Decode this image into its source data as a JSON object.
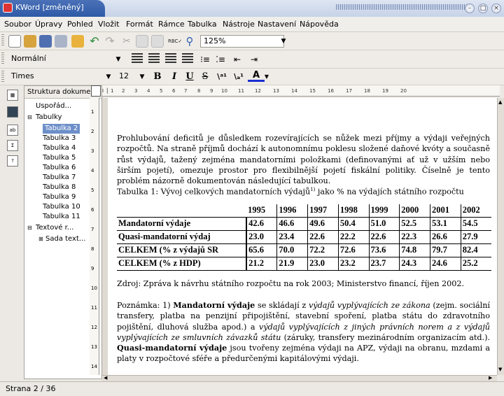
{
  "window": {
    "title": "KWord [změněný]"
  },
  "menubar": {
    "items": [
      "Soubor",
      "Úpravy",
      "Pohled",
      "Vložit",
      "Formát",
      "Rámce",
      "Tabulka",
      "Nástroje",
      "Nastavení",
      "Nápověda"
    ]
  },
  "toolbar": {
    "zoom": "125%",
    "style": "Normální",
    "font": "Times",
    "font_size": "12",
    "bold": "B",
    "italic": "I",
    "underline": "U",
    "strike": "S"
  },
  "doc_structure": {
    "header": "Struktura dokume",
    "items": [
      "Uspořád...",
      "Tabulky",
      "Tabulka 2",
      "Tabulka 3",
      "Tabulka 4",
      "Tabulka 5",
      "Tabulka 6",
      "Tabulka 7",
      "Tabulka 8",
      "Tabulka 9",
      "Tabulka 10",
      "Tabulka 11",
      "Textové r...",
      "Sada text..."
    ]
  },
  "ruler": {
    "numbers": [
      "1",
      "2",
      "3",
      "4",
      "5",
      "6",
      "7",
      "8",
      "9",
      "10",
      "11",
      "12",
      "13",
      "14",
      "15",
      "16",
      "17",
      "18",
      "19",
      "20"
    ],
    "vertical_numbers": [
      "1",
      "2",
      "3",
      "4",
      "5",
      "6",
      "7",
      "8",
      "9",
      "10",
      "11",
      "12",
      "13",
      "14"
    ]
  },
  "document": {
    "para1": "Prohlubování deficitů je důsledkem rozevírajících se nůžek mezi příjmy a výdaji veřejných rozpočtů. Na straně příjmů dochází k autonomnímu poklesu složené daňové kvóty a současně růst výdajů, tažený zejména mandatorními položkami (definovanými ať už v užším nebo širším pojetí), omezuje prostor pro flexibilnější pojetí fiskální politiky. Číselně je tento problém názorně dokumentován následující tabulkou.",
    "caption": "Tabulka 1: Vývoj celkových mandatorních výdajů",
    "caption_sup": "1)",
    "caption_end": " jako % na výdajích státního rozpočtu",
    "table": {
      "years": [
        "1995",
        "1996",
        "1997",
        "1998",
        "1999",
        "2000",
        "2001",
        "2002"
      ],
      "rows": [
        {
          "label": "Mandatorní výdaje",
          "values": [
            "42.6",
            "46.6",
            "49.6",
            "50.4",
            "51.0",
            "52.5",
            "53.1",
            "54.5"
          ]
        },
        {
          "label": "Quasi-mandatorní výdaj",
          "values": [
            "23.0",
            "23.4",
            "22.6",
            "22.2",
            "22.6",
            "22.3",
            "26.6",
            "27.9"
          ]
        },
        {
          "label": "CELKEM (% z výdajů SR",
          "values": [
            "65.6",
            "70.0",
            "72.2",
            "72.6",
            "73.6",
            "74.8",
            "79.7",
            "82.4"
          ]
        },
        {
          "label": "CELKEM (% z HDP)",
          "values": [
            "21.2",
            "21.9",
            "23.0",
            "23.2",
            "23.7",
            "24.3",
            "24.6",
            "25.2"
          ]
        }
      ]
    },
    "source": "Zdroj: Zpráva k návrhu státního rozpočtu na rok 2003; Ministerstvo financí, říjen 2002.",
    "note_prefix": "Poznámka: 1) ",
    "note_b1": "Mandatorní výdaje",
    "note_t1": " se skládají z ",
    "note_i1": "výdajů vyplývajících ze zákona",
    "note_t2": " (zejm. sociální transfery, platba na penzijní připojištění, stavební spoření, platba státu do zdravotního pojištění, dluhová služba apod.) a ",
    "note_i2": "výdajů vyplývajících z jiných právních norem a z výdajů vyplývajících ze smluvních závazků státu",
    "note_t3": " (záruky, transfery mezinárodním organizacím atd.). ",
    "note_b2": "Quasi-mandatorní výdaje",
    "note_t4": " jsou tvořeny zejména výdaji na APZ, výdaji na obranu, mzdami a platy v rozpočtové sféře a předurčenými kapitálovými výdaji."
  },
  "status": {
    "page": "Strana 2 / 36"
  }
}
